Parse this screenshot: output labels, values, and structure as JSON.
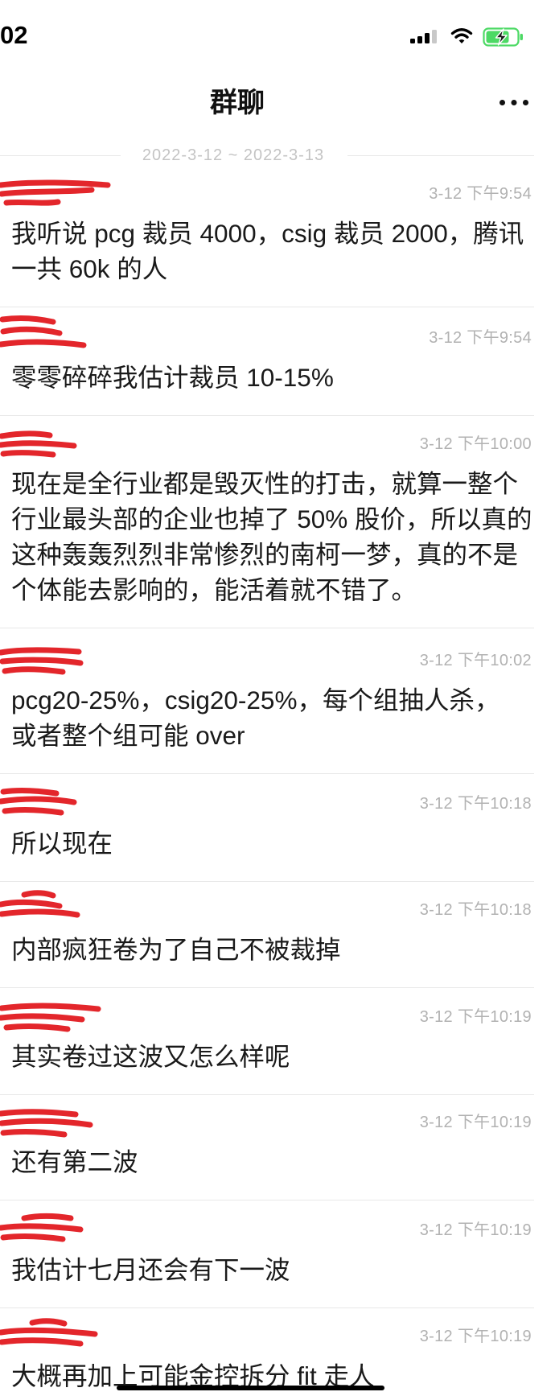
{
  "status_bar": {
    "time": "02",
    "signal_icon": "cellular-signal-icon",
    "wifi_icon": "wifi-icon",
    "battery_icon": "battery-charging-icon"
  },
  "header": {
    "title": "群聊",
    "more_icon": "more-icon"
  },
  "date_range": "2022-3-12 ~ 2022-3-13",
  "messages": [
    {
      "time": "3-12 下午9:54",
      "lines": [
        "我听说 pcg 裁员 4000，csig 裁员 2000，腾讯",
        "一共 60k 的人"
      ]
    },
    {
      "time": "3-12 下午9:54",
      "lines": [
        "零零碎碎我估计裁员 10-15%"
      ]
    },
    {
      "time": "3-12 下午10:00",
      "lines": [
        "现在是全行业都是毁灭性的打击，就算一整个",
        "行业最头部的企业也掉了 50% 股价，所以真的",
        "这种轰轰烈烈非常惨烈的南柯一梦，真的不是",
        "个体能去影响的，能活着就不错了。"
      ]
    },
    {
      "time": "3-12 下午10:02",
      "lines": [
        "pcg20-25%，csig20-25%，每个组抽人杀，",
        "或者整个组可能 over"
      ]
    },
    {
      "time": "3-12 下午10:18",
      "lines": [
        "所以现在"
      ]
    },
    {
      "time": "3-12 下午10:18",
      "lines": [
        "内部疯狂卷为了自己不被裁掉"
      ]
    },
    {
      "time": "3-12 下午10:19",
      "lines": [
        "其实卷过这波又怎么样呢"
      ]
    },
    {
      "time": "3-12 下午10:19",
      "lines": [
        "还有第二波"
      ]
    },
    {
      "time": "3-12 下午10:19",
      "lines": [
        "我估计七月还会有下一波"
      ]
    },
    {
      "time": "3-12 下午10:19",
      "lines": [
        "大概再加上可能金控拆分 fit 走人"
      ]
    }
  ],
  "colors": {
    "background": "#ffffff",
    "text": "#1a1a1a",
    "title": "#111111",
    "timestamp": "#b2b2b2",
    "date": "#c4c4c4",
    "divider": "#e8e8e8",
    "battery": "#4cd964",
    "redaction": "#e3262b"
  }
}
